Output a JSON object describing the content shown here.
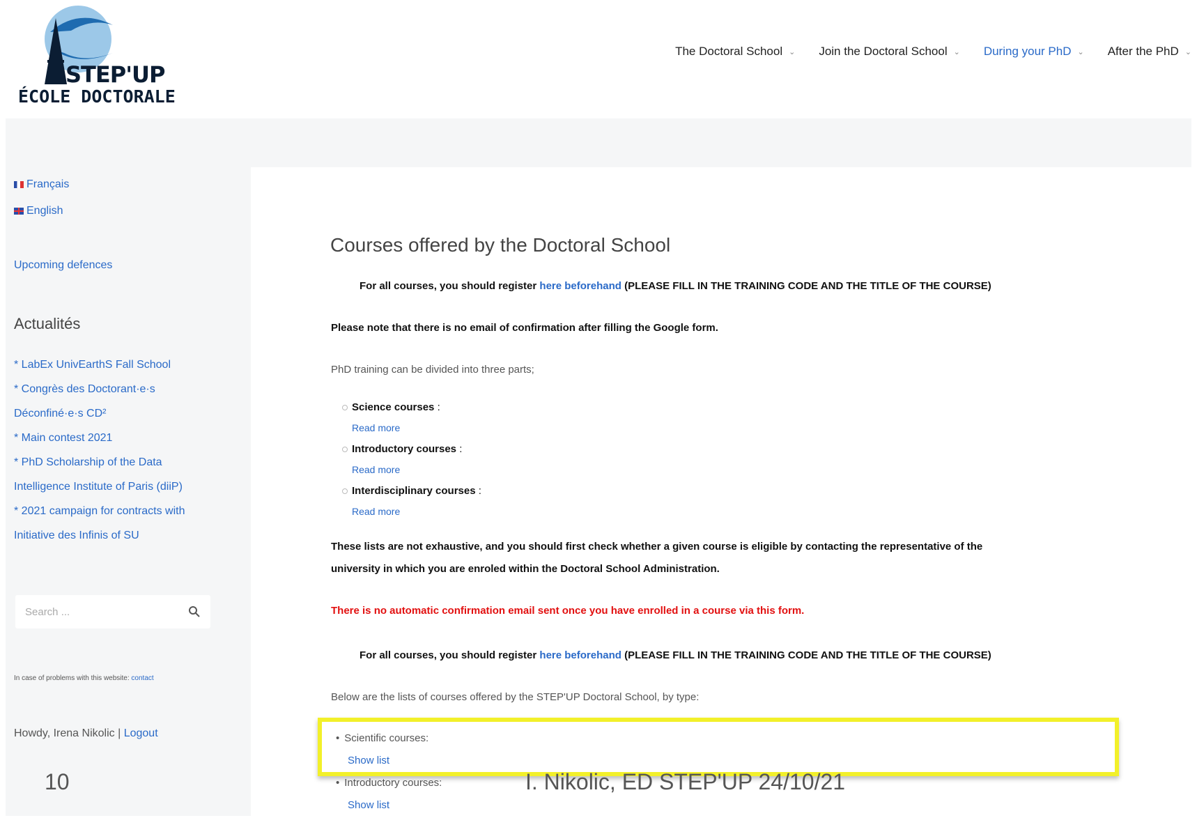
{
  "logo": {
    "name": "STEP'UP",
    "sub": "ÉCOLE DOCTORALE"
  },
  "nav": [
    {
      "label": "The Doctoral School"
    },
    {
      "label": "Join the Doctoral School"
    },
    {
      "label": "During your PhD",
      "active": true
    },
    {
      "label": "After the PhD"
    }
  ],
  "sidebar": {
    "languages": [
      {
        "label": "Français"
      },
      {
        "label": "English"
      }
    ],
    "upcoming": "Upcoming defences",
    "heading": "Actualités",
    "news": [
      "* LabEx UnivEarthS Fall School",
      "* Congrès des Doctorant·e·s",
      "Déconfiné·e·s CD²",
      "* Main contest 2021",
      "* PhD Scholarship of the Data",
      "Intelligence Institute of Paris (diiP)",
      "* 2021 campaign for contracts with",
      "Initiative des Infinis of SU"
    ],
    "search_placeholder": "Search ...",
    "problem_text": "In case of problems with this website:",
    "problem_link": "contact",
    "howdy": "Howdy, Irena Nikolic |",
    "logout": "Logout"
  },
  "main": {
    "title": "Courses offered by the Doctoral School",
    "register_pre": "For all courses, you should register",
    "register_link": "here beforehand",
    "register_post": "(PLEASE FILL IN THE TRAINING CODE AND THE TITLE OF THE COURSE)",
    "note": "Please note that there is no email of confirmation  after  filling the Google form.",
    "intro": "PhD training can be divided into three parts;",
    "parts": [
      {
        "label": "Science courses",
        "suffix": " :",
        "more": "Read more"
      },
      {
        "label": "Introductory courses",
        "suffix": " :",
        "more": "Read more"
      },
      {
        "label": "Interdisciplinary courses",
        "suffix": " :",
        "more": "Read more"
      }
    ],
    "exhaustive_1": "These lists are not exhaustive, and you should first check whether a given course is eligible by contacting the representative of the",
    "exhaustive_2": "university in which you are enroled within the Doctoral School Administration.",
    "warning": "There is no  automatic confirmation email  sent once you have enrolled in a course via this form.",
    "below": "Below are the lists of courses offered by the STEP'UP Doctoral School, by type:",
    "lists": [
      {
        "label": "Scientific courses:",
        "show": "Show list"
      },
      {
        "label": "Introductory courses:",
        "show": "Show list"
      }
    ]
  },
  "slide": {
    "number": "10",
    "footer": "I. Nikolic,   ED STEP'UP 24/10/21"
  },
  "colors": {
    "link": "#2a6ac8",
    "warning": "#e21010",
    "highlight": "#f2f02a"
  }
}
